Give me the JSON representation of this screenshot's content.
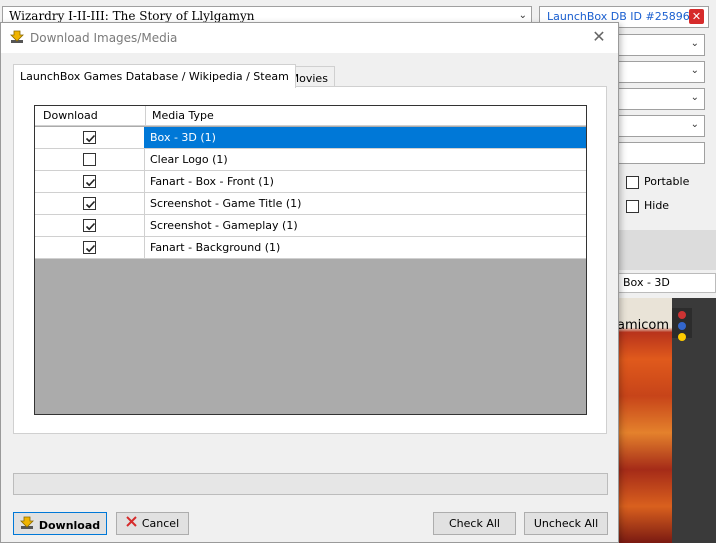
{
  "background": {
    "game_title": "Wizardry I-II-III: The Story of Llylgamyn",
    "db_link": "LaunchBox DB ID #25896",
    "checkbox_portable": "Portable",
    "checkbox_hide": "Hide",
    "image_label": "Box - 3D",
    "image_text": "amicom"
  },
  "dialog": {
    "title": "Download Images/Media",
    "tabs": [
      {
        "label": "LaunchBox Games Database / Wikipedia / Steam",
        "active": true
      },
      {
        "label": "EmuMovies",
        "active": false
      }
    ],
    "grid": {
      "columns": [
        "Download",
        "Media Type"
      ],
      "rows": [
        {
          "checked": true,
          "media_type": "Box - 3D (1)",
          "selected": true
        },
        {
          "checked": false,
          "media_type": "Clear Logo (1)",
          "selected": false
        },
        {
          "checked": true,
          "media_type": "Fanart - Box - Front (1)",
          "selected": false
        },
        {
          "checked": true,
          "media_type": "Screenshot - Game Title (1)",
          "selected": false
        },
        {
          "checked": true,
          "media_type": "Screenshot - Gameplay (1)",
          "selected": false
        },
        {
          "checked": true,
          "media_type": "Fanart - Background (1)",
          "selected": false
        }
      ]
    },
    "progress": 0,
    "buttons": {
      "download": "Download",
      "cancel": "Cancel",
      "check_all": "Check All",
      "uncheck_all": "Uncheck All"
    }
  },
  "colors": {
    "selection": "#0078d7",
    "link": "#1a5fd0",
    "grid_empty": "#ababab",
    "cancel_icon": "#d62b2b"
  },
  "icons": {
    "title": "download-arrow-icon",
    "download_button": "download-arrow-icon",
    "cancel_button": "red-x-icon"
  }
}
